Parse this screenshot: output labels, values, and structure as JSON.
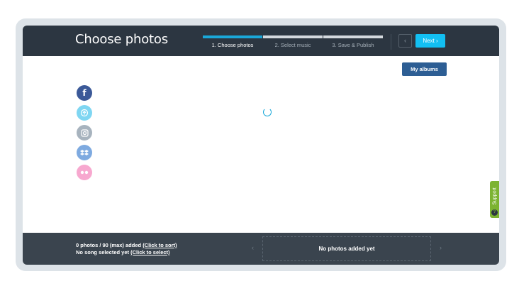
{
  "header": {
    "title": "Choose photos",
    "steps": [
      {
        "label": "1. Choose photos",
        "active": true
      },
      {
        "label": "2. Select music",
        "active": false
      },
      {
        "label": "3. Save & Publish",
        "active": false
      }
    ],
    "prev_glyph": "‹",
    "next_label": "Next ›"
  },
  "main": {
    "albums_button": "My albums",
    "sources": [
      {
        "icon": "facebook-icon",
        "color": "#3b5998"
      },
      {
        "icon": "upload-icon",
        "color": "#7fd6f2"
      },
      {
        "icon": "instagram-icon",
        "color": "#a7b3be"
      },
      {
        "icon": "dropbox-icon",
        "color": "#7eaae0"
      },
      {
        "icon": "flickr-icon",
        "color": "#f7a8cf"
      }
    ]
  },
  "support": {
    "label": "Support",
    "glyph": "?"
  },
  "footer": {
    "photos_text": "0 photos / 90 (max) added ",
    "photos_link": "(Click to sort)",
    "song_text": "No song selected yet ",
    "song_link": "(Click to select)",
    "left_arrow": "‹",
    "right_arrow": "›",
    "empty_message": "No photos added yet"
  },
  "colors": {
    "header_bg": "#2c3641",
    "accent": "#1aa8d9",
    "next_button": "#12bff2",
    "albums_button": "#2d5e94",
    "support_tab": "#7cb332",
    "footer_bg": "#3a444e"
  }
}
